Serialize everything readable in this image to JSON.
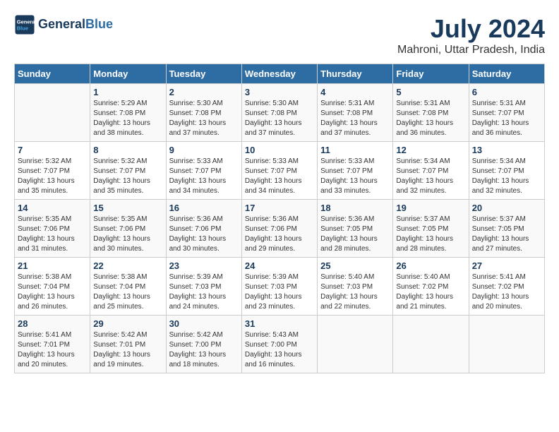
{
  "logo": {
    "line1": "General",
    "line2": "Blue"
  },
  "title": "July 2024",
  "location": "Mahroni, Uttar Pradesh, India",
  "days_of_week": [
    "Sunday",
    "Monday",
    "Tuesday",
    "Wednesday",
    "Thursday",
    "Friday",
    "Saturday"
  ],
  "weeks": [
    [
      {
        "num": "",
        "text": ""
      },
      {
        "num": "1",
        "text": "Sunrise: 5:29 AM\nSunset: 7:08 PM\nDaylight: 13 hours\nand 38 minutes."
      },
      {
        "num": "2",
        "text": "Sunrise: 5:30 AM\nSunset: 7:08 PM\nDaylight: 13 hours\nand 37 minutes."
      },
      {
        "num": "3",
        "text": "Sunrise: 5:30 AM\nSunset: 7:08 PM\nDaylight: 13 hours\nand 37 minutes."
      },
      {
        "num": "4",
        "text": "Sunrise: 5:31 AM\nSunset: 7:08 PM\nDaylight: 13 hours\nand 37 minutes."
      },
      {
        "num": "5",
        "text": "Sunrise: 5:31 AM\nSunset: 7:08 PM\nDaylight: 13 hours\nand 36 minutes."
      },
      {
        "num": "6",
        "text": "Sunrise: 5:31 AM\nSunset: 7:07 PM\nDaylight: 13 hours\nand 36 minutes."
      }
    ],
    [
      {
        "num": "7",
        "text": "Sunrise: 5:32 AM\nSunset: 7:07 PM\nDaylight: 13 hours\nand 35 minutes."
      },
      {
        "num": "8",
        "text": "Sunrise: 5:32 AM\nSunset: 7:07 PM\nDaylight: 13 hours\nand 35 minutes."
      },
      {
        "num": "9",
        "text": "Sunrise: 5:33 AM\nSunset: 7:07 PM\nDaylight: 13 hours\nand 34 minutes."
      },
      {
        "num": "10",
        "text": "Sunrise: 5:33 AM\nSunset: 7:07 PM\nDaylight: 13 hours\nand 34 minutes."
      },
      {
        "num": "11",
        "text": "Sunrise: 5:33 AM\nSunset: 7:07 PM\nDaylight: 13 hours\nand 33 minutes."
      },
      {
        "num": "12",
        "text": "Sunrise: 5:34 AM\nSunset: 7:07 PM\nDaylight: 13 hours\nand 32 minutes."
      },
      {
        "num": "13",
        "text": "Sunrise: 5:34 AM\nSunset: 7:07 PM\nDaylight: 13 hours\nand 32 minutes."
      }
    ],
    [
      {
        "num": "14",
        "text": "Sunrise: 5:35 AM\nSunset: 7:06 PM\nDaylight: 13 hours\nand 31 minutes."
      },
      {
        "num": "15",
        "text": "Sunrise: 5:35 AM\nSunset: 7:06 PM\nDaylight: 13 hours\nand 30 minutes."
      },
      {
        "num": "16",
        "text": "Sunrise: 5:36 AM\nSunset: 7:06 PM\nDaylight: 13 hours\nand 30 minutes."
      },
      {
        "num": "17",
        "text": "Sunrise: 5:36 AM\nSunset: 7:06 PM\nDaylight: 13 hours\nand 29 minutes."
      },
      {
        "num": "18",
        "text": "Sunrise: 5:36 AM\nSunset: 7:05 PM\nDaylight: 13 hours\nand 28 minutes."
      },
      {
        "num": "19",
        "text": "Sunrise: 5:37 AM\nSunset: 7:05 PM\nDaylight: 13 hours\nand 28 minutes."
      },
      {
        "num": "20",
        "text": "Sunrise: 5:37 AM\nSunset: 7:05 PM\nDaylight: 13 hours\nand 27 minutes."
      }
    ],
    [
      {
        "num": "21",
        "text": "Sunrise: 5:38 AM\nSunset: 7:04 PM\nDaylight: 13 hours\nand 26 minutes."
      },
      {
        "num": "22",
        "text": "Sunrise: 5:38 AM\nSunset: 7:04 PM\nDaylight: 13 hours\nand 25 minutes."
      },
      {
        "num": "23",
        "text": "Sunrise: 5:39 AM\nSunset: 7:03 PM\nDaylight: 13 hours\nand 24 minutes."
      },
      {
        "num": "24",
        "text": "Sunrise: 5:39 AM\nSunset: 7:03 PM\nDaylight: 13 hours\nand 23 minutes."
      },
      {
        "num": "25",
        "text": "Sunrise: 5:40 AM\nSunset: 7:03 PM\nDaylight: 13 hours\nand 22 minutes."
      },
      {
        "num": "26",
        "text": "Sunrise: 5:40 AM\nSunset: 7:02 PM\nDaylight: 13 hours\nand 21 minutes."
      },
      {
        "num": "27",
        "text": "Sunrise: 5:41 AM\nSunset: 7:02 PM\nDaylight: 13 hours\nand 20 minutes."
      }
    ],
    [
      {
        "num": "28",
        "text": "Sunrise: 5:41 AM\nSunset: 7:01 PM\nDaylight: 13 hours\nand 20 minutes."
      },
      {
        "num": "29",
        "text": "Sunrise: 5:42 AM\nSunset: 7:01 PM\nDaylight: 13 hours\nand 19 minutes."
      },
      {
        "num": "30",
        "text": "Sunrise: 5:42 AM\nSunset: 7:00 PM\nDaylight: 13 hours\nand 18 minutes."
      },
      {
        "num": "31",
        "text": "Sunrise: 5:43 AM\nSunset: 7:00 PM\nDaylight: 13 hours\nand 16 minutes."
      },
      {
        "num": "",
        "text": ""
      },
      {
        "num": "",
        "text": ""
      },
      {
        "num": "",
        "text": ""
      }
    ]
  ]
}
